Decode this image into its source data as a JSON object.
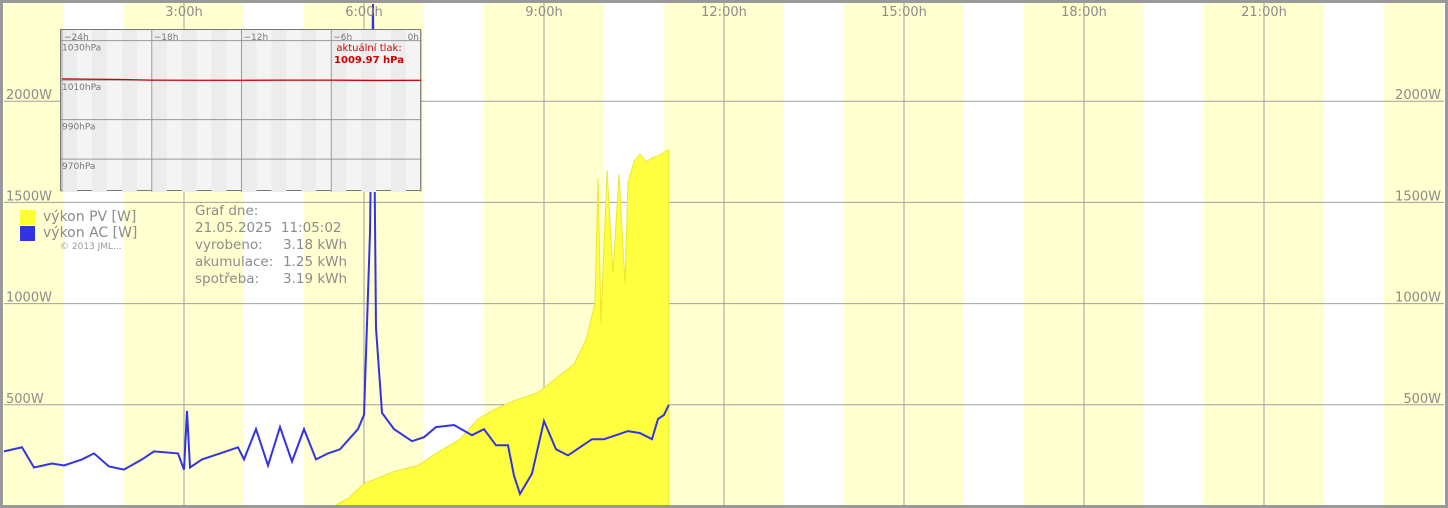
{
  "chart_data": {
    "type": "area",
    "x_unit": "hours of day",
    "xlim": [
      0,
      24
    ],
    "ylim": [
      0,
      2500
    ],
    "x_ticks": [
      "3:00h",
      "6:00h",
      "9:00h",
      "12:00h",
      "15:00h",
      "18:00h",
      "21:00h"
    ],
    "x_tick_values": [
      3,
      6,
      9,
      12,
      15,
      18,
      21
    ],
    "y_ticks": [
      "500W",
      "1000W",
      "1500W",
      "2000W"
    ],
    "y_tick_values": [
      500,
      1000,
      1500,
      2000
    ],
    "grid": true,
    "series": [
      {
        "name": "výkon PV [W]",
        "color": "#ffff40",
        "kind": "area",
        "points": [
          [
            5.5,
            0
          ],
          [
            5.75,
            40
          ],
          [
            6.0,
            110
          ],
          [
            6.5,
            170
          ],
          [
            6.9,
            200
          ],
          [
            7.2,
            260
          ],
          [
            7.6,
            330
          ],
          [
            7.9,
            430
          ],
          [
            8.2,
            480
          ],
          [
            8.5,
            520
          ],
          [
            8.9,
            560
          ],
          [
            9.2,
            630
          ],
          [
            9.5,
            700
          ],
          [
            9.7,
            820
          ],
          [
            9.85,
            1000
          ],
          [
            9.9,
            1620
          ],
          [
            9.95,
            900
          ],
          [
            10.05,
            1660
          ],
          [
            10.15,
            1150
          ],
          [
            10.25,
            1640
          ],
          [
            10.35,
            1100
          ],
          [
            10.4,
            1600
          ],
          [
            10.5,
            1700
          ],
          [
            10.6,
            1740
          ],
          [
            10.7,
            1700
          ],
          [
            10.8,
            1720
          ],
          [
            10.9,
            1730
          ],
          [
            11.08,
            1760
          ]
        ]
      },
      {
        "name": "výkon AC [W]",
        "color": "#3333e6",
        "kind": "line",
        "points": [
          [
            0,
            270
          ],
          [
            0.3,
            290
          ],
          [
            0.5,
            190
          ],
          [
            0.8,
            210
          ],
          [
            1.0,
            200
          ],
          [
            1.3,
            230
          ],
          [
            1.5,
            260
          ],
          [
            1.75,
            195
          ],
          [
            2.0,
            180
          ],
          [
            2.3,
            230
          ],
          [
            2.5,
            270
          ],
          [
            2.9,
            260
          ],
          [
            3.0,
            180
          ],
          [
            3.05,
            470
          ],
          [
            3.1,
            190
          ],
          [
            3.3,
            230
          ],
          [
            3.6,
            260
          ],
          [
            3.9,
            290
          ],
          [
            4.0,
            230
          ],
          [
            4.2,
            380
          ],
          [
            4.4,
            200
          ],
          [
            4.6,
            390
          ],
          [
            4.8,
            220
          ],
          [
            5.0,
            380
          ],
          [
            5.2,
            230
          ],
          [
            5.4,
            260
          ],
          [
            5.6,
            280
          ],
          [
            5.9,
            380
          ],
          [
            6.0,
            450
          ],
          [
            6.1,
            1350
          ],
          [
            6.15,
            2480
          ],
          [
            6.2,
            880
          ],
          [
            6.3,
            460
          ],
          [
            6.5,
            380
          ],
          [
            6.8,
            320
          ],
          [
            7.0,
            340
          ],
          [
            7.2,
            390
          ],
          [
            7.5,
            400
          ],
          [
            7.8,
            350
          ],
          [
            8.0,
            380
          ],
          [
            8.2,
            300
          ],
          [
            8.4,
            300
          ],
          [
            8.5,
            150
          ],
          [
            8.6,
            60
          ],
          [
            8.8,
            160
          ],
          [
            9.0,
            420
          ],
          [
            9.2,
            280
          ],
          [
            9.4,
            250
          ],
          [
            9.6,
            290
          ],
          [
            9.8,
            330
          ],
          [
            10.0,
            330
          ],
          [
            10.2,
            350
          ],
          [
            10.4,
            370
          ],
          [
            10.6,
            360
          ],
          [
            10.8,
            330
          ],
          [
            10.9,
            430
          ],
          [
            11.0,
            450
          ],
          [
            11.08,
            500
          ]
        ]
      }
    ],
    "info": {
      "title": "Graf dne:",
      "datetime": "21.05.2025  11:05:02",
      "rows": [
        {
          "label": "vyrobeno:",
          "value": "3.18 kWh"
        },
        {
          "label": "akumulace:",
          "value": "1.25 kWh"
        },
        {
          "label": "spotřeba:",
          "value": "3.19 kWh"
        }
      ]
    },
    "copyright": "© 2013 JML...",
    "inset_pressure": {
      "type": "line",
      "x_ticks": [
        "−24h",
        "−18h",
        "−12h",
        "−6h",
        "0h"
      ],
      "x_tick_values": [
        -24,
        -18,
        -12,
        -6,
        0
      ],
      "y_ticks": [
        "1030hPa",
        "1010hPa",
        "990hPa",
        "970hPa"
      ],
      "y_tick_values": [
        1030,
        1010,
        990,
        970
      ],
      "ylim": [
        965,
        1045
      ],
      "xlim": [
        -24,
        0
      ],
      "line_color": "#cc0000",
      "points": [
        [
          -24,
          1010.6
        ],
        [
          -20,
          1010.3
        ],
        [
          -18,
          1010.0
        ],
        [
          -15,
          1009.9
        ],
        [
          -12,
          1009.9
        ],
        [
          -9,
          1010.0
        ],
        [
          -6,
          1010.0
        ],
        [
          -3,
          1009.8
        ],
        [
          0,
          1009.9
        ]
      ],
      "current_label": "aktuální tlak:",
      "current_value": "1009.97 hPa"
    }
  }
}
